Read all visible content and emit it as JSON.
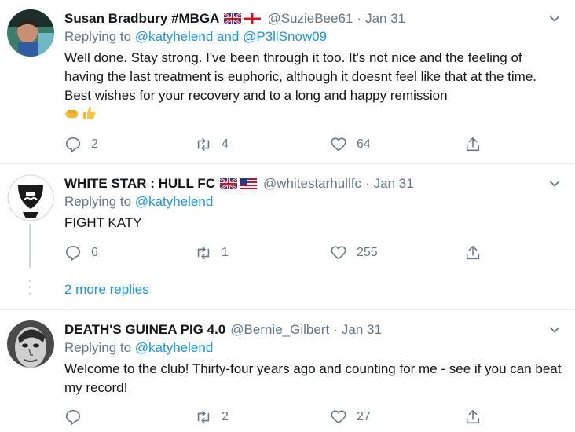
{
  "tweets": [
    {
      "name": "Susan Bradbury #MBGA",
      "flags": [
        "uk-flag",
        "england-flag"
      ],
      "handle": "@SuzieBee61",
      "date": "Jan 31",
      "replying_prefix": "Replying to",
      "replying_to": "@katyhelend and @P3llSnow09",
      "text": "Well done. Stay strong. I've been through it too. It's not nice and the feeling of having the last treatment is euphoric, although it doesnt feel like that at the time. Best wishes for your recovery and to a long and happy remission",
      "emojis": [
        "fist-emoji",
        "thumbs-up-emoji"
      ],
      "replies": "2",
      "retweets": "4",
      "likes": "64"
    },
    {
      "name": "WHITE STAR : HULL FC",
      "flags": [
        "uk-flag",
        "us-flag"
      ],
      "handle": "@whitestarhullfc",
      "date": "Jan 31",
      "replying_prefix": "Replying to",
      "replying_to": "@katyhelend",
      "text": "FIGHT KATY",
      "replies": "6",
      "retweets": "1",
      "likes": "255"
    },
    {
      "name": "DEATH'S GUINEA PIG 4.0",
      "handle": "@Bernie_Gilbert",
      "date": "Jan 31",
      "replying_prefix": "Replying to",
      "replying_to": "@katyhelend",
      "text": "Welcome to the club! Thirty-four years ago and counting for me - see if you can beat my record!",
      "replies": "",
      "retweets": "2",
      "likes": "27"
    }
  ],
  "more_replies": "2 more replies",
  "colors": {
    "link": "#1b95e0",
    "muted": "#657786",
    "divider": "#e6ecf0",
    "thread_line": "#ccd6dd"
  }
}
